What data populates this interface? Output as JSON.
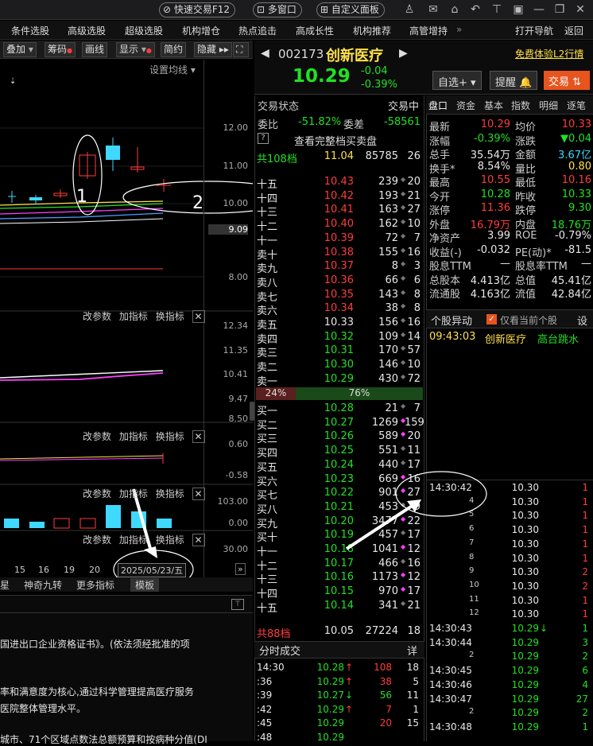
{
  "topbar": {
    "quick_trade": "快速交易F12",
    "multi_window": "多窗口",
    "custom_panel": "自定义面板"
  },
  "nav": {
    "items": [
      "条件选股",
      "高级选股",
      "超级选股",
      "机构增仓",
      "热点追击",
      "高成长性",
      "机构推荐",
      "高管增持"
    ],
    "more": "»",
    "open_nav": "打开导航",
    "back": "返回"
  },
  "toolbar": {
    "items": [
      "叠加",
      "筹码",
      "画线",
      "显示",
      "简约",
      "隐藏"
    ],
    "ma_setting": "设置均线"
  },
  "chart": {
    "price_axis": [
      "12.00",
      "11.00",
      "10.00",
      "9.09",
      "8.00"
    ],
    "vol_axis": [
      "12.34",
      "11.35",
      "10.41",
      "9.47",
      "8.50"
    ],
    "macd_axis": [
      "0.60",
      "-0.58"
    ],
    "bar_axis": [
      "103.00",
      "0.00"
    ],
    "extra_axis": [
      "30.00"
    ],
    "subpanel": {
      "change_params": "改参数",
      "add_indicator": "加指标",
      "switch_indicator": "换指标"
    },
    "dates": [
      "15",
      "16",
      "19",
      "20"
    ],
    "date_box": "2025/05/23/五",
    "annot1": "1",
    "annot2": "2"
  },
  "bottom_tabs": [
    "星",
    "神奇九转",
    "更多指标",
    "模板"
  ],
  "news": {
    "lines": [
      "国进出口企业资格证书》。(依法须经批准的项",
      "率和满意度为核心,通过科学管理提高医疗服务",
      "医院整体管理水平。",
      "城市、71个区域点数法总额预算和按病种分值(DI"
    ]
  },
  "stock": {
    "code": "002173",
    "name": "创新医疗",
    "price": "10.29",
    "change": "-0.04",
    "change_pct": "-0.39%",
    "trial": "免费体验L2行情",
    "btn_self": "自选+",
    "btn_alert": "提醒",
    "btn_trade": "交易"
  },
  "order_book": {
    "status": "交易状态",
    "state": "交易中",
    "webi_label": "委比",
    "webi": "-51.82%",
    "wecha_label": "委差",
    "wecha": "-58561",
    "view_full": "查看完整档买卖盘",
    "total_sell": {
      "label": "共108档",
      "price": "11.04",
      "vol": "85785",
      "cnt": "26"
    },
    "sells": [
      {
        "l": "十五",
        "p": "10.43",
        "v": "239",
        "c": "20"
      },
      {
        "l": "十四",
        "p": "10.42",
        "v": "193",
        "c": "21"
      },
      {
        "l": "十三",
        "p": "10.41",
        "v": "163",
        "c": "27"
      },
      {
        "l": "十二",
        "p": "10.40",
        "v": "162",
        "c": "10"
      },
      {
        "l": "十一",
        "p": "10.39",
        "v": "72",
        "c": "7"
      },
      {
        "l": "卖十",
        "p": "10.38",
        "v": "155",
        "c": "16"
      },
      {
        "l": "卖九",
        "p": "10.37",
        "v": "8",
        "c": "3"
      },
      {
        "l": "卖八",
        "p": "10.36",
        "v": "66",
        "c": "6"
      },
      {
        "l": "卖七",
        "p": "10.35",
        "v": "143",
        "c": "8"
      },
      {
        "l": "卖六",
        "p": "10.34",
        "v": "38",
        "c": "8"
      },
      {
        "l": "卖五",
        "p": "10.33",
        "v": "156",
        "c": "16"
      },
      {
        "l": "卖四",
        "p": "10.32",
        "v": "109",
        "c": "14"
      },
      {
        "l": "卖三",
        "p": "10.31",
        "v": "170",
        "c": "57"
      },
      {
        "l": "卖二",
        "p": "10.30",
        "v": "146",
        "c": "10"
      },
      {
        "l": "卖一",
        "p": "10.29",
        "v": "430",
        "c": "72"
      }
    ],
    "ratio_sell": "24%",
    "ratio_buy": "76%",
    "buys": [
      {
        "l": "买一",
        "p": "10.28",
        "v": "21",
        "c": "7"
      },
      {
        "l": "买二",
        "p": "10.27",
        "v": "1269",
        "c": "159"
      },
      {
        "l": "买三",
        "p": "10.26",
        "v": "589",
        "c": "20"
      },
      {
        "l": "买四",
        "p": "10.25",
        "v": "551",
        "c": "11"
      },
      {
        "l": "买五",
        "p": "10.24",
        "v": "440",
        "c": "17"
      },
      {
        "l": "买六",
        "p": "10.23",
        "v": "669",
        "c": "16"
      },
      {
        "l": "买七",
        "p": "10.22",
        "v": "901",
        "c": "27"
      },
      {
        "l": "买八",
        "p": "10.21",
        "v": "453",
        "c": "9"
      },
      {
        "l": "买九",
        "p": "10.20",
        "v": "3477",
        "c": "22"
      },
      {
        "l": "买十",
        "p": "10.19",
        "v": "457",
        "c": "17"
      },
      {
        "l": "十一",
        "p": "10.18",
        "v": "1041",
        "c": "12"
      },
      {
        "l": "十二",
        "p": "10.17",
        "v": "466",
        "c": "16"
      },
      {
        "l": "十三",
        "p": "10.16",
        "v": "1173",
        "c": "12"
      },
      {
        "l": "十四",
        "p": "10.15",
        "v": "970",
        "c": "17"
      },
      {
        "l": "十五",
        "p": "10.14",
        "v": "341",
        "c": "21"
      }
    ],
    "total_buy": {
      "label": "共88档",
      "price": "10.05",
      "vol": "27224",
      "cnt": "18"
    }
  },
  "fenshi": {
    "title": "分时成交",
    "detail": "详",
    "rows": [
      {
        "t": "14:30",
        "p": "10.28",
        "a": "↑",
        "v": "108",
        "c": "18"
      },
      {
        "t": ":36",
        "p": "10.29",
        "a": "↑",
        "v": "38",
        "c": "5"
      },
      {
        "t": ":39",
        "p": "10.27",
        "a": "↓",
        "v": "56",
        "c": "11"
      },
      {
        "t": ":42",
        "p": "10.29",
        "a": "↑",
        "v": "7",
        "c": "1"
      },
      {
        "t": ":45",
        "p": "10.29",
        "a": "",
        "v": "20",
        "c": "15"
      },
      {
        "t": ":48",
        "p": "10.29",
        "a": "",
        "v": "",
        "c": ""
      }
    ]
  },
  "right": {
    "tabs": [
      "盘口",
      "资金",
      "基本",
      "指数",
      "明细",
      "逐笔"
    ],
    "stats": [
      [
        "最新",
        "10.29",
        "均价",
        "10.33"
      ],
      [
        "涨幅",
        "-0.39%",
        "涨跌",
        "▼0.04"
      ],
      [
        "总手",
        "35.54万",
        "金额",
        "3.67亿"
      ],
      [
        "换手*",
        "8.54%",
        "量比",
        "0.80"
      ],
      [
        "最高",
        "10.55",
        "最低",
        "10.16"
      ],
      [
        "今开",
        "10.28",
        "昨收",
        "10.33"
      ],
      [
        "涨停",
        "11.36",
        "跌停",
        "9.30"
      ],
      [
        "外盘",
        "16.79万",
        "内盘",
        "18.76万"
      ],
      [
        "净资产",
        "3.99",
        "ROE",
        "-0.79%"
      ],
      [
        "收益(-)",
        "-0.032",
        "PE(动)*",
        "-81.5"
      ],
      [
        "股息TTM",
        "—",
        "股息率TTM",
        "—"
      ],
      [
        "总股本",
        "4.413亿",
        "总值",
        "45.41亿"
      ],
      [
        "流通股",
        "4.163亿",
        "流值",
        "42.84亿"
      ]
    ],
    "anomaly_title": "个股异动",
    "only_current": "仅看当前个股",
    "settings": "设",
    "anomaly": {
      "time": "09:43:03",
      "name": "创新医疗",
      "event": "高台跳水"
    },
    "ticks": [
      {
        "t": "14:30:42",
        "p": "10.30",
        "v": "1"
      },
      {
        "t": "4",
        "p": "10.30",
        "v": "1"
      },
      {
        "t": "5",
        "p": "10.30",
        "v": "1"
      },
      {
        "t": "6",
        "p": "10.30",
        "v": "1"
      },
      {
        "t": "7",
        "p": "10.30",
        "v": "1"
      },
      {
        "t": "8",
        "p": "10.30",
        "v": "1"
      },
      {
        "t": "9",
        "p": "10.30",
        "v": "2"
      },
      {
        "t": "10",
        "p": "10.30",
        "v": "2"
      },
      {
        "t": "11",
        "p": "10.30",
        "v": "1"
      },
      {
        "t": "12",
        "p": "10.30",
        "v": "1"
      },
      {
        "t": "14:30:43",
        "p": "10.29",
        "a": "↓",
        "v": "1"
      },
      {
        "t": "14:30:44",
        "p": "10.29",
        "v": "3"
      },
      {
        "t": "2",
        "p": "10.29",
        "v": "2"
      },
      {
        "t": "14:30:45",
        "p": "10.29",
        "v": "6"
      },
      {
        "t": "14:30:46",
        "p": "10.29",
        "v": "4"
      },
      {
        "t": "14:30:47",
        "p": "10.29",
        "v": "27"
      },
      {
        "t": "2",
        "p": "10.29",
        "v": "2"
      },
      {
        "t": "14:30:48",
        "p": "10.29",
        "v": "1"
      }
    ]
  },
  "colors": {
    "up": "#ff3c3c",
    "down": "#22e022",
    "accent": "#ffe14a",
    "trade_btn": "#e8541e"
  }
}
